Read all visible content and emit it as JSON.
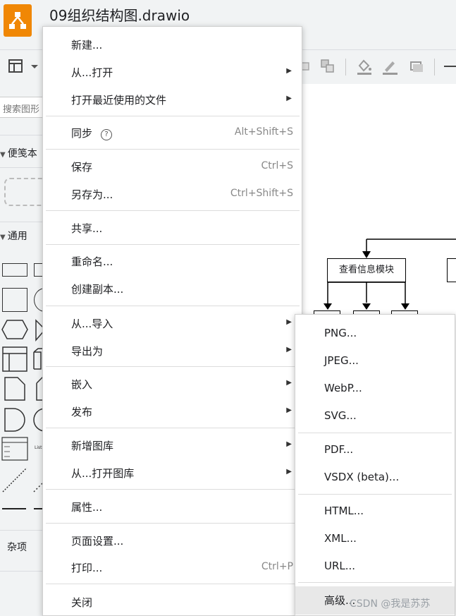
{
  "app": {
    "title": "09组织结构图.drawio",
    "accent_color": "#f08705"
  },
  "left_panel": {
    "search_placeholder": "搜索图形",
    "sections": [
      {
        "label": "便笺本"
      },
      {
        "label": "通用"
      },
      {
        "label": "杂项"
      }
    ],
    "list_label": "List"
  },
  "canvas": {
    "node_label": "查看信息模块"
  },
  "menu": {
    "items": [
      {
        "label": "新建..."
      },
      {
        "label": "从...打开"
      },
      {
        "label": "打开最近使用的文件"
      },
      {
        "label": "同步",
        "shortcut": "Alt+Shift+S"
      },
      {
        "label": "保存",
        "shortcut": "Ctrl+S"
      },
      {
        "label": "另存为...",
        "shortcut": "Ctrl+Shift+S"
      },
      {
        "label": "共享..."
      },
      {
        "label": "重命名..."
      },
      {
        "label": "创建副本..."
      },
      {
        "label": "从...导入"
      },
      {
        "label": "导出为"
      },
      {
        "label": "嵌入"
      },
      {
        "label": "发布"
      },
      {
        "label": "新增图库"
      },
      {
        "label": "从...打开图库"
      },
      {
        "label": "属性..."
      },
      {
        "label": "页面设置..."
      },
      {
        "label": "打印...",
        "shortcut": "Ctrl+P"
      },
      {
        "label": "关闭"
      }
    ]
  },
  "export_submenu": {
    "items": [
      {
        "label": "PNG..."
      },
      {
        "label": "JPEG..."
      },
      {
        "label": "WebP..."
      },
      {
        "label": "SVG..."
      },
      {
        "label": "PDF..."
      },
      {
        "label": "VSDX (beta)..."
      },
      {
        "label": "HTML..."
      },
      {
        "label": "XML..."
      },
      {
        "label": "URL..."
      },
      {
        "label": "高级..."
      }
    ]
  },
  "watermark": "CSDN @我是苏苏"
}
